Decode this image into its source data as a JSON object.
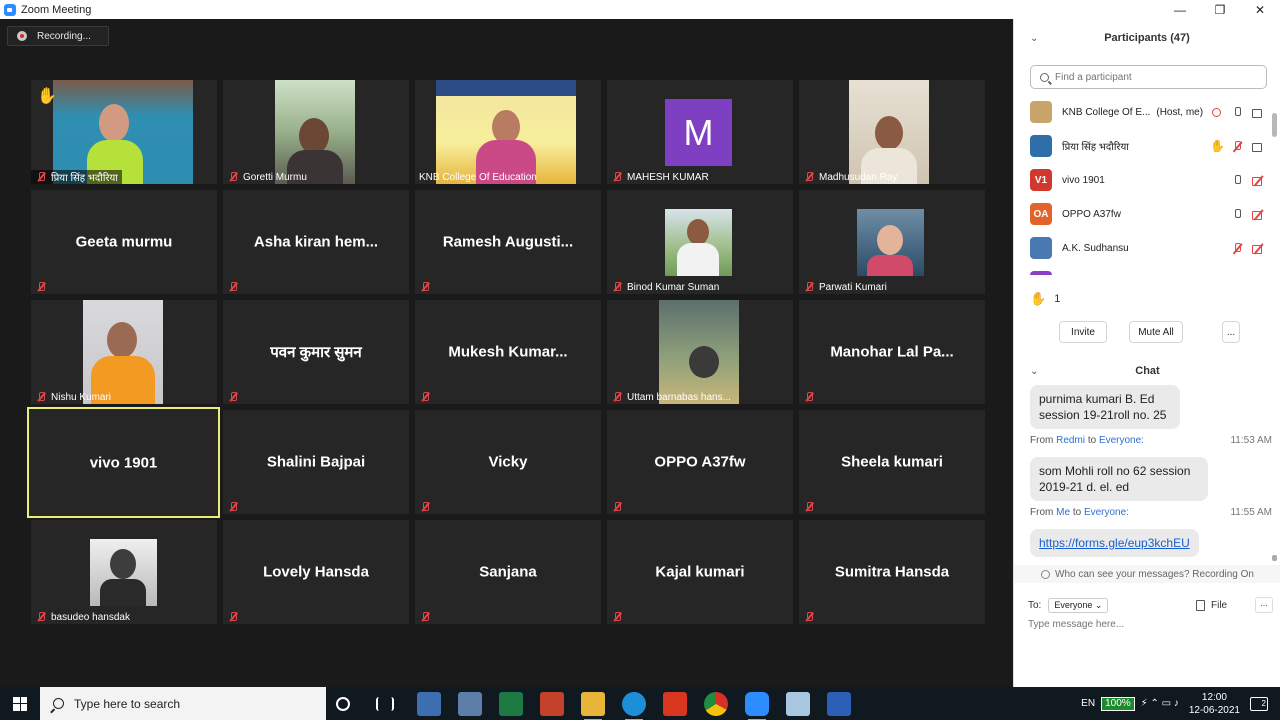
{
  "window": {
    "title": "Zoom Meeting",
    "minimize": "—",
    "maximize": "❐",
    "close": "✕"
  },
  "meeting": {
    "recording_label": "Recording...",
    "tiles": [
      {
        "label": "प्रिया सिंह भदौरिया",
        "hand": true
      },
      {
        "label": "Goretti Murmu"
      },
      {
        "label": "KNB College Of Education"
      },
      {
        "label": "MAHESH KUMAR",
        "letter": "M"
      },
      {
        "label": "Madhusudan Ray"
      },
      {
        "center": "Geeta murmu"
      },
      {
        "center": "Asha kiran hem..."
      },
      {
        "center": "Ramesh Augusti..."
      },
      {
        "label": "Binod Kumar Suman"
      },
      {
        "label": "Parwati Kumari"
      },
      {
        "label": "Nishu Kumari"
      },
      {
        "center": "पवन कुमार सुमन"
      },
      {
        "center": "Mukesh Kumar..."
      },
      {
        "label": "Uttam barnabas hans..."
      },
      {
        "center": "Manohar Lal Pa..."
      },
      {
        "center": "vivo 1901",
        "active": true
      },
      {
        "center": "Shalini Bajpai"
      },
      {
        "center": "Vicky"
      },
      {
        "center": "OPPO A37fw"
      },
      {
        "center": "Sheela kumari"
      },
      {
        "label": "basudeo hansdak"
      },
      {
        "center": "Lovely Hansda"
      },
      {
        "center": "Sanjana"
      },
      {
        "center": "Kajal kumari"
      },
      {
        "center": "Sumitra Hansda"
      }
    ]
  },
  "participants": {
    "title": "Participants (47)",
    "search_placeholder": "Find a participant",
    "list": [
      {
        "name": "KNB College Of E...",
        "tag": "(Host, me)",
        "avatar_text": "",
        "avatar_color": "#c9a46a"
      },
      {
        "name": "प्रिया सिंह भदौरिया",
        "tag": "",
        "avatar_text": "",
        "avatar_color": "#2f6fa8"
      },
      {
        "name": "vivo 1901",
        "tag": "",
        "avatar_text": "V1",
        "avatar_color": "#d2382e"
      },
      {
        "name": "OPPO A37fw",
        "tag": "",
        "avatar_text": "OA",
        "avatar_color": "#e2642a"
      },
      {
        "name": "A.K. Sudhansu",
        "tag": "",
        "avatar_text": "",
        "avatar_color": "#4a78b0"
      },
      {
        "name": "",
        "tag": "",
        "avatar_text": "",
        "avatar_color": "#8a3fc4"
      }
    ],
    "raised_count": "1",
    "invite": "Invite",
    "mute_all": "Mute All",
    "more": "..."
  },
  "chat": {
    "title": "Chat",
    "messages": [
      {
        "text": "purnima kumari B. Ed session 19-21roll no. 25"
      },
      {
        "from_prefix": "From",
        "from": "Redmi",
        "to_word": "to",
        "to": "Everyone:",
        "time": "11:53 AM",
        "text": "som Mohli roll no 62 session 2019-21 d. el. ed"
      },
      {
        "from_prefix": "From",
        "from": "Me",
        "to_word": "to",
        "to": "Everyone:",
        "time": "11:55 AM",
        "text": "https://forms.gle/eup3kchEU"
      }
    ],
    "visibility": "Who can see your messages? Recording On",
    "to_label": "To:",
    "to_value": "Everyone ⌄",
    "file_label": "File",
    "more": "...",
    "input_placeholder": "Type message here..."
  },
  "taskbar": {
    "search_placeholder": "Type here to search",
    "language": "EN",
    "battery": "100%",
    "time": "12:00",
    "date": "12-06-2021",
    "notifications": "2"
  }
}
